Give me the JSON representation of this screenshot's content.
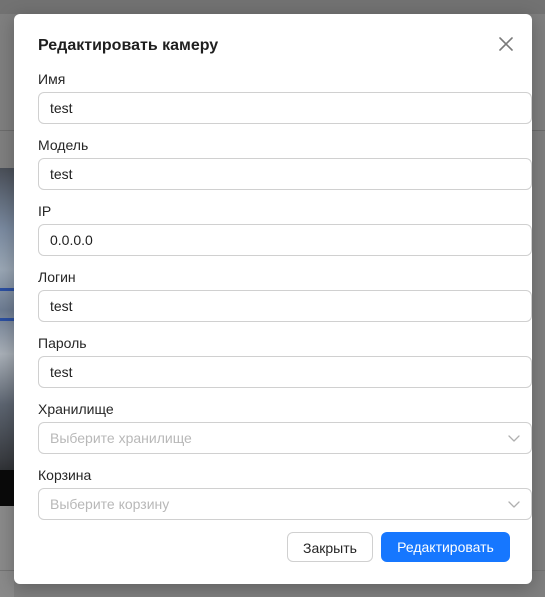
{
  "dialog": {
    "title": "Редактировать камеру",
    "close_icon": "close-icon"
  },
  "fields": {
    "name": {
      "label": "Имя",
      "value": "test"
    },
    "model": {
      "label": "Модель",
      "value": "test"
    },
    "ip": {
      "label": "IP",
      "value": "0.0.0.0"
    },
    "login": {
      "label": "Логин",
      "value": "test"
    },
    "password": {
      "label": "Пароль",
      "value": "test"
    },
    "storage": {
      "label": "Хранилище",
      "placeholder": "Выберите хранилище",
      "icon": "chevron-down-icon"
    },
    "bin": {
      "label": "Корзина",
      "placeholder": "Выберите корзину",
      "icon": "chevron-down-icon"
    }
  },
  "footer": {
    "close_label": "Закрыть",
    "submit_label": "Редактировать"
  },
  "colors": {
    "primary": "#1677ff",
    "overlay": "#7f7f7f",
    "border": "#d0d0d0",
    "placeholder": "#b8b8b8"
  }
}
